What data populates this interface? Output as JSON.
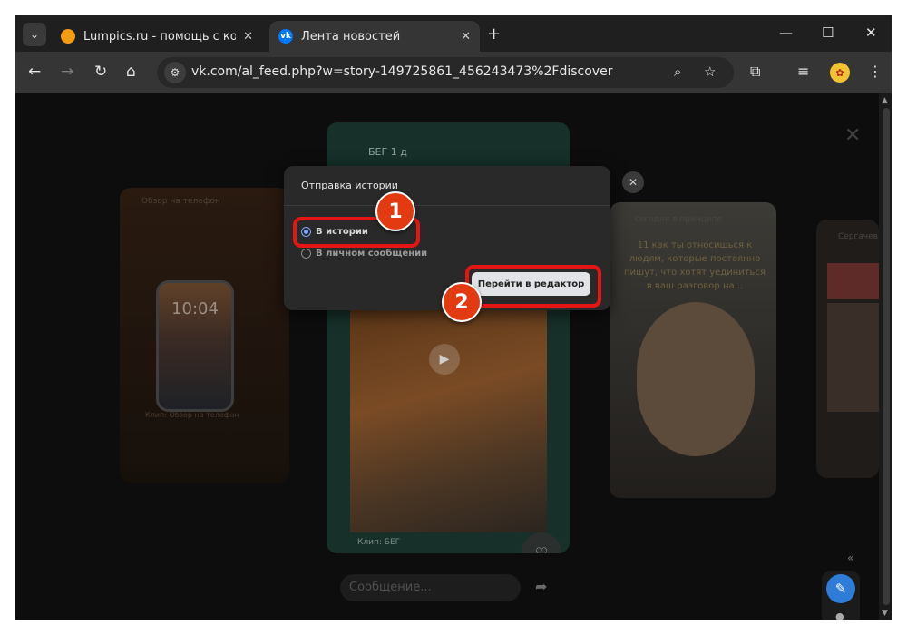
{
  "browser": {
    "tabs": [
      {
        "title": "Lumpics.ru - помощь с компьютером",
        "favicon": "lumpics-orange-icon",
        "active": false
      },
      {
        "title": "Лента новостей",
        "favicon": "vk-icon",
        "active": true
      }
    ],
    "new_tab_label": "+",
    "address": "vk.com/al_feed.php?w=story-149725861_456243473%2Fdiscover",
    "window_controls": {
      "minimize": "—",
      "maximize": "☐",
      "close": "✕"
    }
  },
  "feed": {
    "left_card_caption": "Обзор на телефон",
    "left_card_clock": "10:04",
    "left_card_footer": "Клип: Обзор на телефон",
    "center_author": "БЕГ 1 д",
    "center_clip_label": "Клип: БЕГ",
    "right_card_header": "сегодня в принципе",
    "right_card_quote": "11 как ты относишься к людям, которые постоянно пишут, что хотят уединиться в ваш разговор на...",
    "far_card_header": "Сергачев",
    "message_placeholder": "Сообщение...",
    "collapse_label": "«"
  },
  "dialog": {
    "title": "Отправка истории",
    "options": [
      {
        "label": "В истории",
        "selected": true
      },
      {
        "label": "В личном сообщении",
        "selected": false
      }
    ],
    "primary_button": "Перейти в редактор",
    "close_label": "✕"
  },
  "annotations": {
    "step1": "1",
    "step2": "2"
  },
  "colors": {
    "accent": "#7aa9ff",
    "highlight": "#e31515",
    "badge": "#e33a12",
    "vk_blue": "#0077ff"
  }
}
